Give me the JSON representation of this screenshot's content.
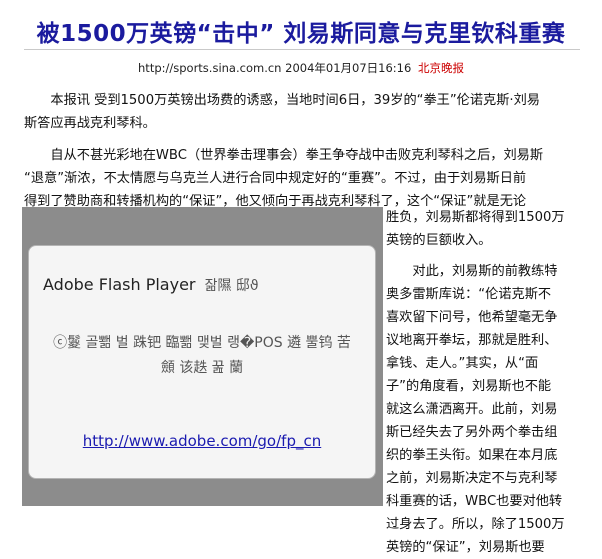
{
  "article": {
    "headline": "被1500万英镑“击中” 刘易斯同意与克里钦科重赛",
    "meta": {
      "url": "http://sports.sina.com.cn",
      "datetime": "2004年01月07日16:16",
      "source": "北京晚报"
    },
    "para1": [
      "本报讯 受到1500万英镑出场费的诱惑，当地时间6日，39岁的“拳王”伦诺克斯·刘易",
      "斯答应再战克利琴科。"
    ],
    "para2_full": [
      "自从不甚光彩地在WBC（世界拳击理事会）拳王争夺战中击败克利琴科之后，刘易斯",
      "“退意”渐浓，不太情愿与乌克兰人进行合同中规定好的“重赛”。不过，由于刘易斯日前",
      "得到了赞助商和转播机构的“保证”，他又倾向于再战克利琴科了，这个“保证”就是无论"
    ],
    "para2_narrow": [
      "胜负，刘易斯都将得到1500万",
      "英镑的巨额收入。"
    ],
    "para3_narrow": [
      "对此，刘易斯的前教练特",
      "奥多雷斯库说：“伦诺克斯不",
      "喜欢留下问号，他希望毫无争",
      "议地离开拳坛，那就是胜利、",
      "拿钱、走人。”其实，从“面",
      "子”的角度看，刘易斯也不能",
      "就这么潇洒离开。此前，刘易",
      "斯已经失去了另外两个拳击组",
      "织的拳王头衔。如果在本月底",
      "之前，刘易斯决定不与克利琴",
      "科重赛的话，WBC也要对他转",
      "过身去了。所以，除了1500万",
      "英镑的“保证”，刘易斯也要"
    ]
  },
  "flash_player": {
    "title": "Adobe Flash Player",
    "title_garbled": "잚隰 邸ϑ",
    "message": "ⓒ鬉 골뾂 벌 跦钯 臨뾂 맺벌 랭�POS 遴 뿔钨 苦顩 该趃 꿆 蘭",
    "link": "http://www.adobe.com/go/fp_cn"
  },
  "colors": {
    "headline": "#1b1b9e",
    "source": "#cc0000",
    "link": "#1a1ab0",
    "flash_bg": "#8c8c8c"
  }
}
